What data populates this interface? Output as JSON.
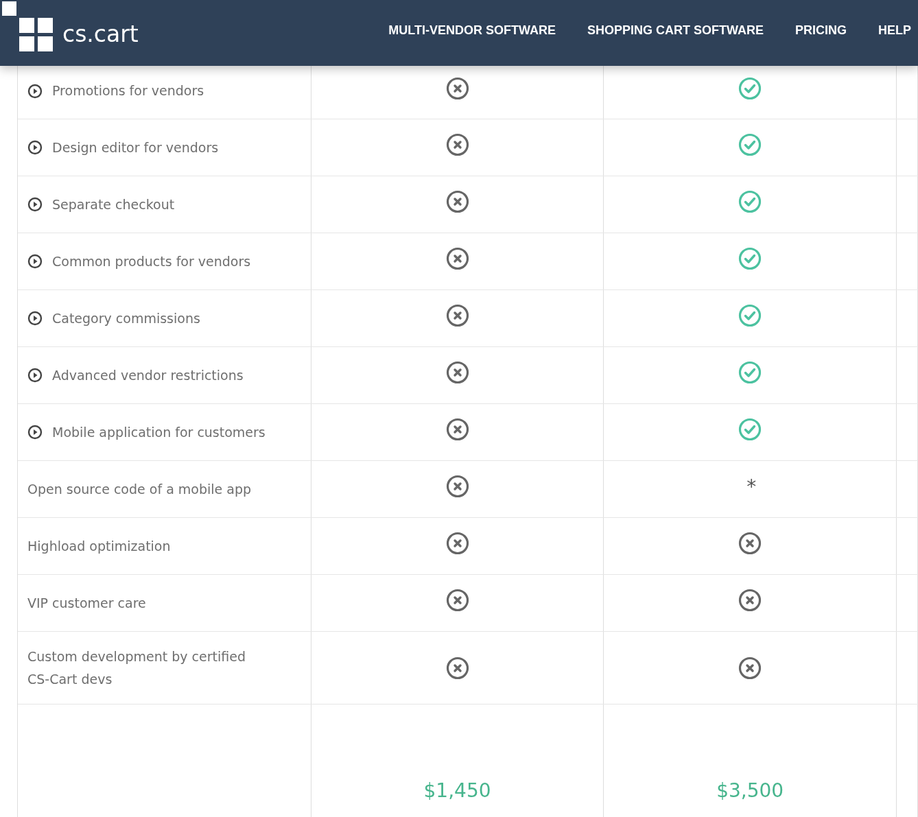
{
  "header": {
    "logo": "cs.cart",
    "nav": [
      {
        "label": "MULTI-VENDOR SOFTWARE"
      },
      {
        "label": "SHOPPING CART SOFTWARE"
      },
      {
        "label": "PRICING"
      },
      {
        "label": "HELP"
      }
    ]
  },
  "rows": [
    {
      "feature": "Promotions for vendors",
      "expandable": true,
      "cells": [
        {
          "kind": "no"
        },
        {
          "kind": "yes"
        }
      ]
    },
    {
      "feature": "Design editor for vendors",
      "expandable": true,
      "cells": [
        {
          "kind": "no"
        },
        {
          "kind": "yes"
        }
      ]
    },
    {
      "feature": "Separate checkout",
      "expandable": true,
      "cells": [
        {
          "kind": "no"
        },
        {
          "kind": "yes"
        }
      ]
    },
    {
      "feature": "Common products for vendors",
      "expandable": true,
      "cells": [
        {
          "kind": "no"
        },
        {
          "kind": "yes"
        }
      ]
    },
    {
      "feature": "Category commissions",
      "expandable": true,
      "cells": [
        {
          "kind": "no"
        },
        {
          "kind": "yes"
        }
      ]
    },
    {
      "feature": "Advanced vendor restrictions",
      "expandable": true,
      "cells": [
        {
          "kind": "no"
        },
        {
          "kind": "yes"
        }
      ]
    },
    {
      "feature": "Mobile application for customers",
      "expandable": true,
      "cells": [
        {
          "kind": "no"
        },
        {
          "kind": "yes"
        }
      ]
    },
    {
      "feature": "Open source code of a mobile app",
      "expandable": false,
      "cells": [
        {
          "kind": "no"
        },
        {
          "kind": "note",
          "text": "*"
        }
      ]
    },
    {
      "feature": "Highload optimization",
      "expandable": false,
      "cells": [
        {
          "kind": "no"
        },
        {
          "kind": "no"
        }
      ]
    },
    {
      "feature": "VIP customer care",
      "expandable": false,
      "cells": [
        {
          "kind": "no"
        },
        {
          "kind": "no"
        }
      ]
    },
    {
      "feature": "Custom development by certified CS-Cart devs",
      "expandable": false,
      "cells": [
        {
          "kind": "no"
        },
        {
          "kind": "no"
        }
      ]
    }
  ],
  "prices": [
    "$1,450",
    "$3,500"
  ]
}
